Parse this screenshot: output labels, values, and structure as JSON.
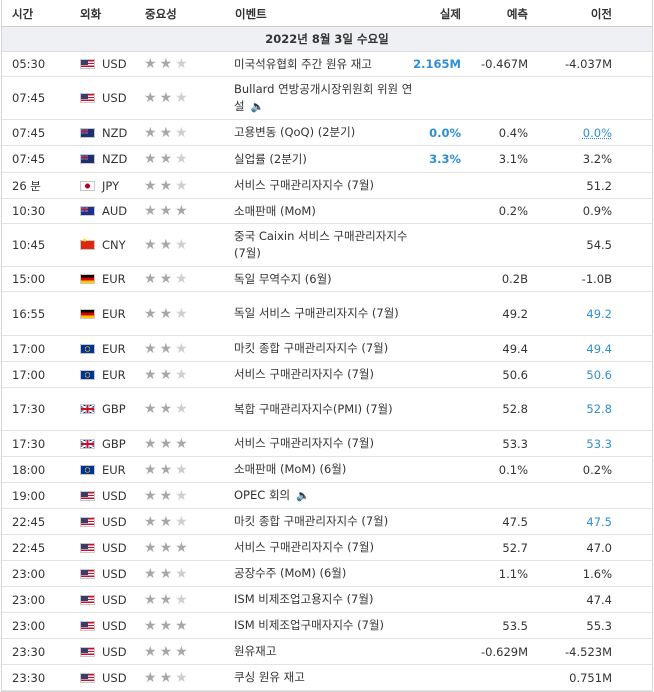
{
  "header": {
    "time": "시간",
    "currency": "외화",
    "importance": "중요성",
    "event": "이벤트",
    "actual": "실제",
    "forecast": "예측",
    "previous": "이전"
  },
  "date_label": "2022년 8월 3일 수요일",
  "events": [
    {
      "time": "05:30",
      "currency": "USD",
      "flag": "USD",
      "stars": 2,
      "event": "미국석유협회 주간 원유 재고",
      "speaker": false,
      "actual": "2.165M",
      "forecast": "-0.467M",
      "previous": "-4.037M",
      "prev_style": "",
      "h": 25
    },
    {
      "time": "07:45",
      "currency": "USD",
      "flag": "USD",
      "stars": 2,
      "event": "Bullard 연방공개시장위원회 위원 연설",
      "speaker": true,
      "actual": "",
      "forecast": "",
      "previous": "",
      "prev_style": "",
      "h": 43
    },
    {
      "time": "07:45",
      "currency": "NZD",
      "flag": "NZD",
      "stars": 2,
      "event": "고용변동 (QoQ) (2분기)",
      "speaker": false,
      "actual": "0.0%",
      "forecast": "0.4%",
      "previous": "0.0%",
      "prev_style": "ul",
      "h": 26
    },
    {
      "time": "07:45",
      "currency": "NZD",
      "flag": "NZD",
      "stars": 2,
      "event": "실업률 (2분기)",
      "speaker": false,
      "actual": "3.3%",
      "forecast": "3.1%",
      "previous": "3.2%",
      "prev_style": "",
      "h": 27
    },
    {
      "time": "26 분",
      "currency": "JPY",
      "flag": "JPY",
      "stars": 2,
      "event": "서비스 구매관리자지수 (7월)",
      "speaker": false,
      "actual": "",
      "forecast": "",
      "previous": "51.2",
      "prev_style": "",
      "h": 26
    },
    {
      "time": "10:30",
      "currency": "AUD",
      "flag": "AUD",
      "stars": 3,
      "event": "소매판매 (MoM)",
      "speaker": false,
      "actual": "",
      "forecast": "0.2%",
      "previous": "0.9%",
      "prev_style": "",
      "h": 25
    },
    {
      "time": "10:45",
      "currency": "CNY",
      "flag": "CNY",
      "stars": 2,
      "event": "중국 Caixin 서비스 구매관리자지수 (7월)",
      "speaker": false,
      "actual": "",
      "forecast": "",
      "previous": "54.5",
      "prev_style": "",
      "h": 43
    },
    {
      "time": "15:00",
      "currency": "EUR",
      "flag": "EUR-de",
      "stars": 2,
      "event": "독일 무역수지 (6월)",
      "speaker": false,
      "actual": "",
      "forecast": "0.2B",
      "previous": "-1.0B",
      "prev_style": "",
      "h": 25
    },
    {
      "time": "16:55",
      "currency": "EUR",
      "flag": "EUR-de",
      "stars": 2,
      "event": "독일 서비스 구매관리자지수 (7월)",
      "speaker": false,
      "actual": "",
      "forecast": "49.2",
      "previous": "49.2",
      "prev_style": "blue",
      "h": 44
    },
    {
      "time": "17:00",
      "currency": "EUR",
      "flag": "EUR",
      "stars": 2,
      "event": "마킷 종합 구매관리자지수 (7월)",
      "speaker": false,
      "actual": "",
      "forecast": "49.4",
      "previous": "49.4",
      "prev_style": "blue",
      "h": 26
    },
    {
      "time": "17:00",
      "currency": "EUR",
      "flag": "EUR",
      "stars": 2,
      "event": "서비스 구매관리자지수 (7월)",
      "speaker": false,
      "actual": "",
      "forecast": "50.6",
      "previous": "50.6",
      "prev_style": "blue",
      "h": 26
    },
    {
      "time": "17:30",
      "currency": "GBP",
      "flag": "GBP",
      "stars": 2,
      "event": "복합 구매관리자지수(PMI) (7월)",
      "speaker": false,
      "actual": "",
      "forecast": "52.8",
      "previous": "52.8",
      "prev_style": "blue",
      "h": 43
    },
    {
      "time": "17:30",
      "currency": "GBP",
      "flag": "GBP",
      "stars": 3,
      "event": "서비스 구매관리자지수 (7월)",
      "speaker": false,
      "actual": "",
      "forecast": "53.3",
      "previous": "53.3",
      "prev_style": "blue",
      "h": 26
    },
    {
      "time": "18:00",
      "currency": "EUR",
      "flag": "EUR",
      "stars": 2,
      "event": "소매판매 (MoM) (6월)",
      "speaker": false,
      "actual": "",
      "forecast": "0.1%",
      "previous": "0.2%",
      "prev_style": "",
      "h": 26
    },
    {
      "time": "19:00",
      "currency": "USD",
      "flag": "USD",
      "stars": 2,
      "event": "OPEC 회의",
      "speaker": true,
      "actual": "",
      "forecast": "",
      "previous": "",
      "prev_style": "",
      "h": 26
    },
    {
      "time": "22:45",
      "currency": "USD",
      "flag": "USD",
      "stars": 2,
      "event": "마킷 종합 구매관리자지수 (7월)",
      "speaker": false,
      "actual": "",
      "forecast": "47.5",
      "previous": "47.5",
      "prev_style": "blue",
      "h": 26
    },
    {
      "time": "22:45",
      "currency": "USD",
      "flag": "USD",
      "stars": 3,
      "event": "서비스 구매관리자지수 (7월)",
      "speaker": false,
      "actual": "",
      "forecast": "52.7",
      "previous": "47.0",
      "prev_style": "",
      "h": 26
    },
    {
      "time": "23:00",
      "currency": "USD",
      "flag": "USD",
      "stars": 2,
      "event": "공장수주 (MoM) (6월)",
      "speaker": false,
      "actual": "",
      "forecast": "1.1%",
      "previous": "1.6%",
      "prev_style": "",
      "h": 26
    },
    {
      "time": "23:00",
      "currency": "USD",
      "flag": "USD",
      "stars": 2,
      "event": "ISM 비제조업고용지수 (7월)",
      "speaker": false,
      "actual": "",
      "forecast": "",
      "previous": "47.4",
      "prev_style": "",
      "h": 26
    },
    {
      "time": "23:00",
      "currency": "USD",
      "flag": "USD",
      "stars": 3,
      "event": "ISM 비제조업구매자지수 (7월)",
      "speaker": false,
      "actual": "",
      "forecast": "53.5",
      "previous": "55.3",
      "prev_style": "",
      "h": 26
    },
    {
      "time": "23:30",
      "currency": "USD",
      "flag": "USD",
      "stars": 3,
      "event": "원유재고",
      "speaker": false,
      "actual": "",
      "forecast": "-0.629M",
      "previous": "-4.523M",
      "prev_style": "",
      "h": 26
    },
    {
      "time": "23:30",
      "currency": "USD",
      "flag": "USD",
      "stars": 2,
      "event": "쿠싱 원유 재고",
      "speaker": false,
      "actual": "",
      "forecast": "",
      "previous": "0.751M",
      "prev_style": "",
      "h": 26
    }
  ]
}
